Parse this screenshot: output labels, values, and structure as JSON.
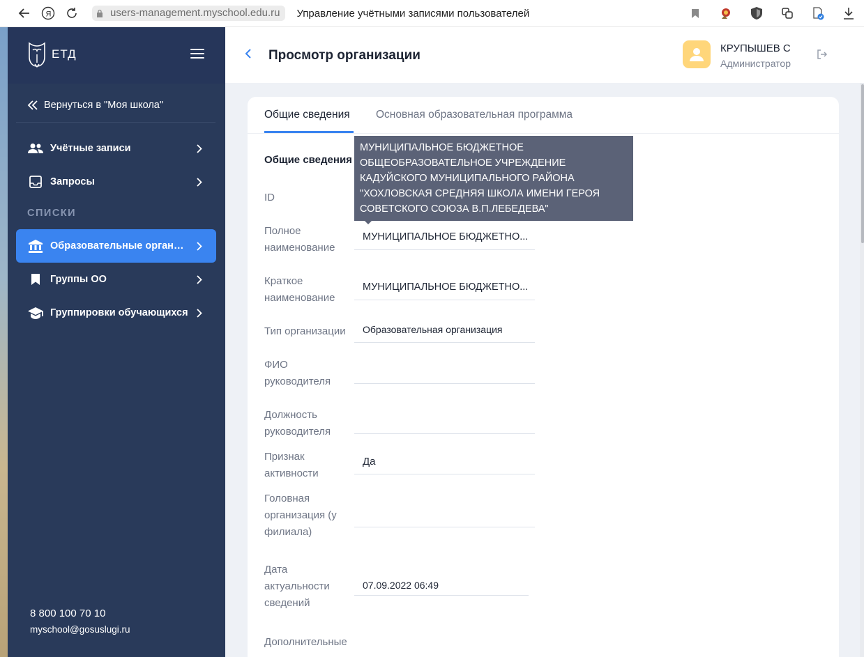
{
  "browser": {
    "url": "users-management.myschool.edu.ru",
    "tab_title": "Управление учётными записями пользователей"
  },
  "sidebar": {
    "logo_text": "ЕТД",
    "back_label": "Вернуться в \"Моя школа\"",
    "items": [
      {
        "label": "Учётные записи",
        "icon": "users-icon"
      },
      {
        "label": "Запросы",
        "icon": "inbox-icon"
      }
    ],
    "section_title": "СПИСКИ",
    "list_items": [
      {
        "label": "Образовательные организации",
        "icon": "institution-icon",
        "active": true
      },
      {
        "label": "Группы ОО",
        "icon": "bookmark-icon",
        "active": false
      },
      {
        "label": "Группировки обучающихся",
        "icon": "graduation-cap-icon",
        "active": false
      }
    ],
    "phone": "8 800 100 70 10",
    "email": "myschool@gosuslugi.ru"
  },
  "header": {
    "title": "Просмотр организации",
    "user_name": "КРУПЫШЕВ С",
    "user_role": "Администратор"
  },
  "tabs": [
    {
      "label": "Общие сведения",
      "active": true
    },
    {
      "label": "Основная образовательная программа",
      "active": false
    }
  ],
  "form": {
    "section_title": "Общие сведения",
    "fields": [
      {
        "label": "ID",
        "value": ""
      },
      {
        "label": "Полное наименование",
        "value": "МУНИЦИПАЛЬНОЕ БЮДЖЕТНО..."
      },
      {
        "label": "Краткое наименование",
        "value": "МУНИЦИПАЛЬНОЕ БЮДЖЕТНО..."
      },
      {
        "label": "Тип организации",
        "value": "Образовательная организация"
      },
      {
        "label": "ФИО руководителя",
        "value": ""
      },
      {
        "label": "Должность руководителя",
        "value": ""
      },
      {
        "label": "Признак активности",
        "value": "Да"
      },
      {
        "label": "Головная организация (у филиала)",
        "value": ""
      },
      {
        "label": "Дата актуальности сведений",
        "value": "07.09.2022 06:49"
      },
      {
        "label": "Дополнительные",
        "value": ""
      }
    ]
  },
  "tooltip": {
    "text": "МУНИЦИПАЛЬНОЕ БЮДЖЕТНОЕ ОБЩЕОБРАЗОВАТЕЛЬНОЕ УЧРЕЖДЕНИЕ КАДУЙСКОГО МУНИЦИПАЛЬНОГО РАЙОНА \"ХОХЛОВСКАЯ СРЕДНЯЯ ШКОЛА ИМЕНИ ГЕРОЯ СОВЕТСКОГО СОЮЗА В.П.ЛЕБЕДЕВА\""
  },
  "colors": {
    "sidebar": "#293a5a",
    "accent": "#3a84f0",
    "tooltip": "#5b6277",
    "avatar": "#ffd67a"
  }
}
